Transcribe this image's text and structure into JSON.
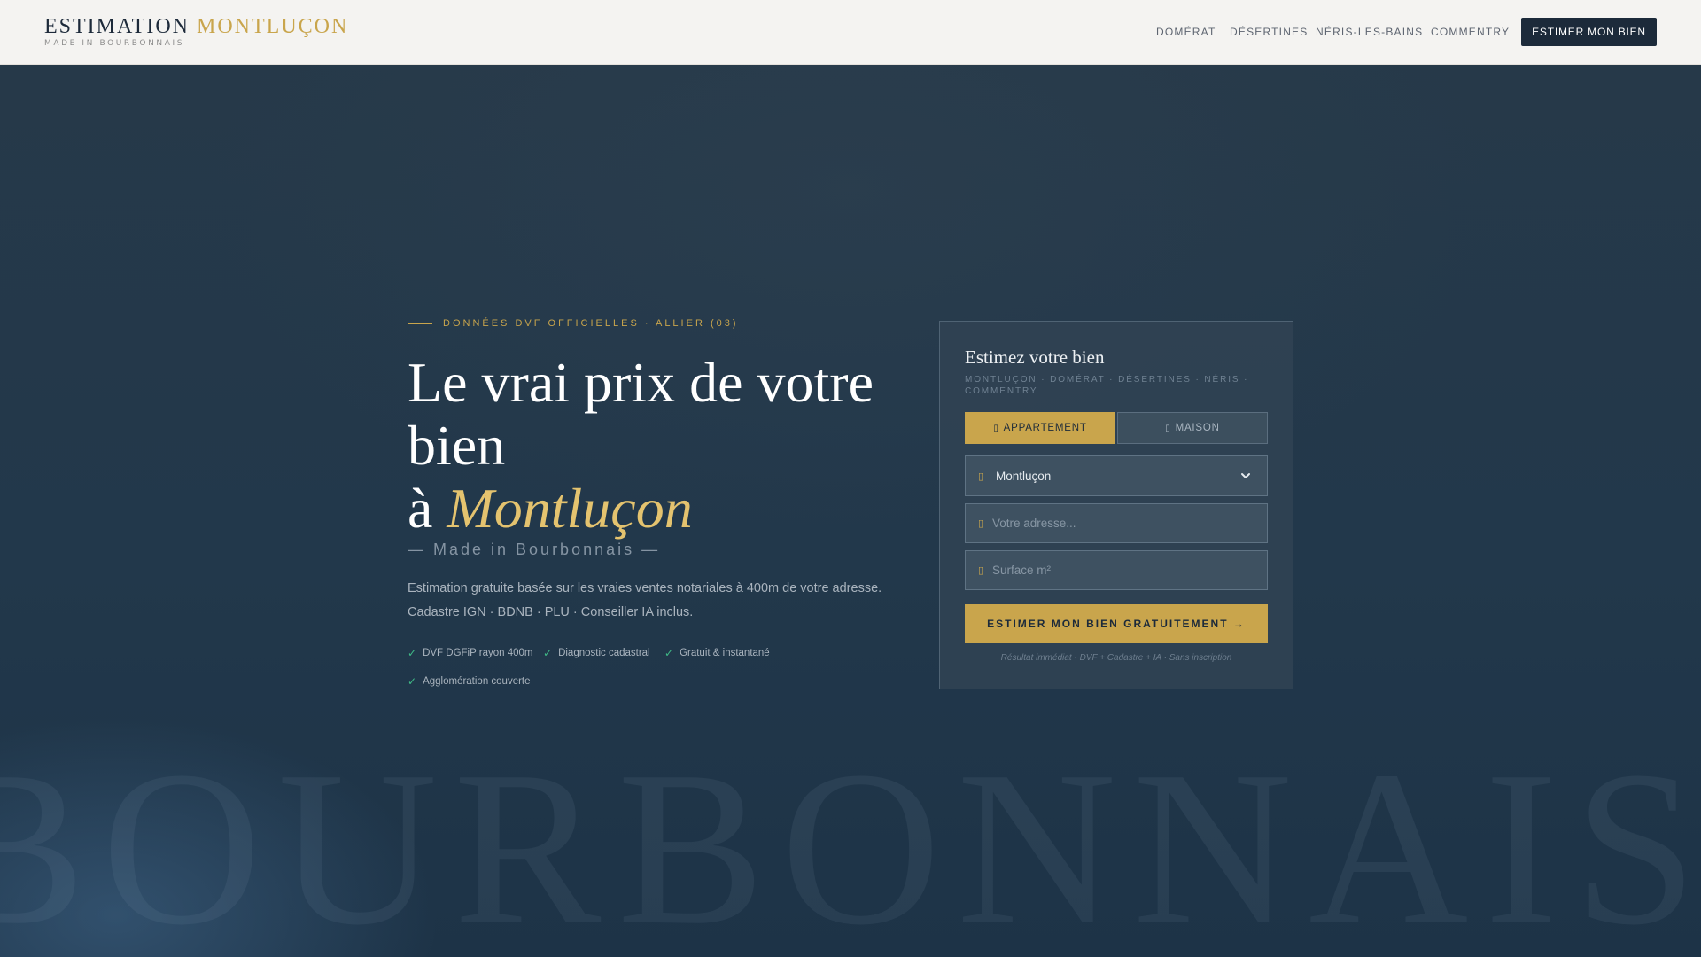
{
  "header": {
    "brand_part1": "ESTIMATION",
    "brand_part2": "MONTLUÇON",
    "brand_sub": "MADE IN BOURBONNAIS",
    "nav": [
      "DOMÉRAT",
      "DÉSERTINES",
      "NÉRIS-LES-BAINS",
      "COMMENTRY"
    ],
    "cta": "ESTIMER MON BIEN"
  },
  "hero": {
    "watermark": "BOURBONNAIS",
    "eyebrow": "DONNÉES DVF OFFICIELLES · ALLIER (03)",
    "headline_line1": "Le vrai prix de votre bien",
    "headline_prefix": "à",
    "headline_city": "Montluçon",
    "tagline": "— Made in Bourbonnais —",
    "lead_line1": "Estimation gratuite basée sur les vraies ventes notariales à 400m de votre adresse.",
    "lead_line2": "Cadastre IGN · BDNB · PLU · Conseiller IA inclus.",
    "check_mark": "✓",
    "checks": [
      "DVF DGFiP rayon 400m",
      "Diagnostic cadastral",
      "Gratuit & instantané",
      "Agglomération couverte"
    ]
  },
  "form": {
    "title": "Estimez votre bien",
    "subtitle": "MONTLUÇON · DOMÉRAT · DÉSERTINES · NÉRIS · COMMENTRY",
    "tab_icon": "▯",
    "tabs": [
      "APPARTEMENT",
      "MAISON"
    ],
    "active_tab": "APPARTEMENT",
    "field_icon": "▯",
    "city_value": "Montluçon",
    "address_placeholder": "Votre adresse...",
    "surface_placeholder": "Surface m²",
    "submit": "ESTIMER MON BIEN GRATUITEMENT →",
    "fine_print": "Résultat immédiat · DVF + Cadastre + IA · Sans inscription"
  },
  "colors": {
    "accent_gold": "#c9a54c",
    "navy": "#1c2a3a",
    "check_green": "#3fba86"
  }
}
